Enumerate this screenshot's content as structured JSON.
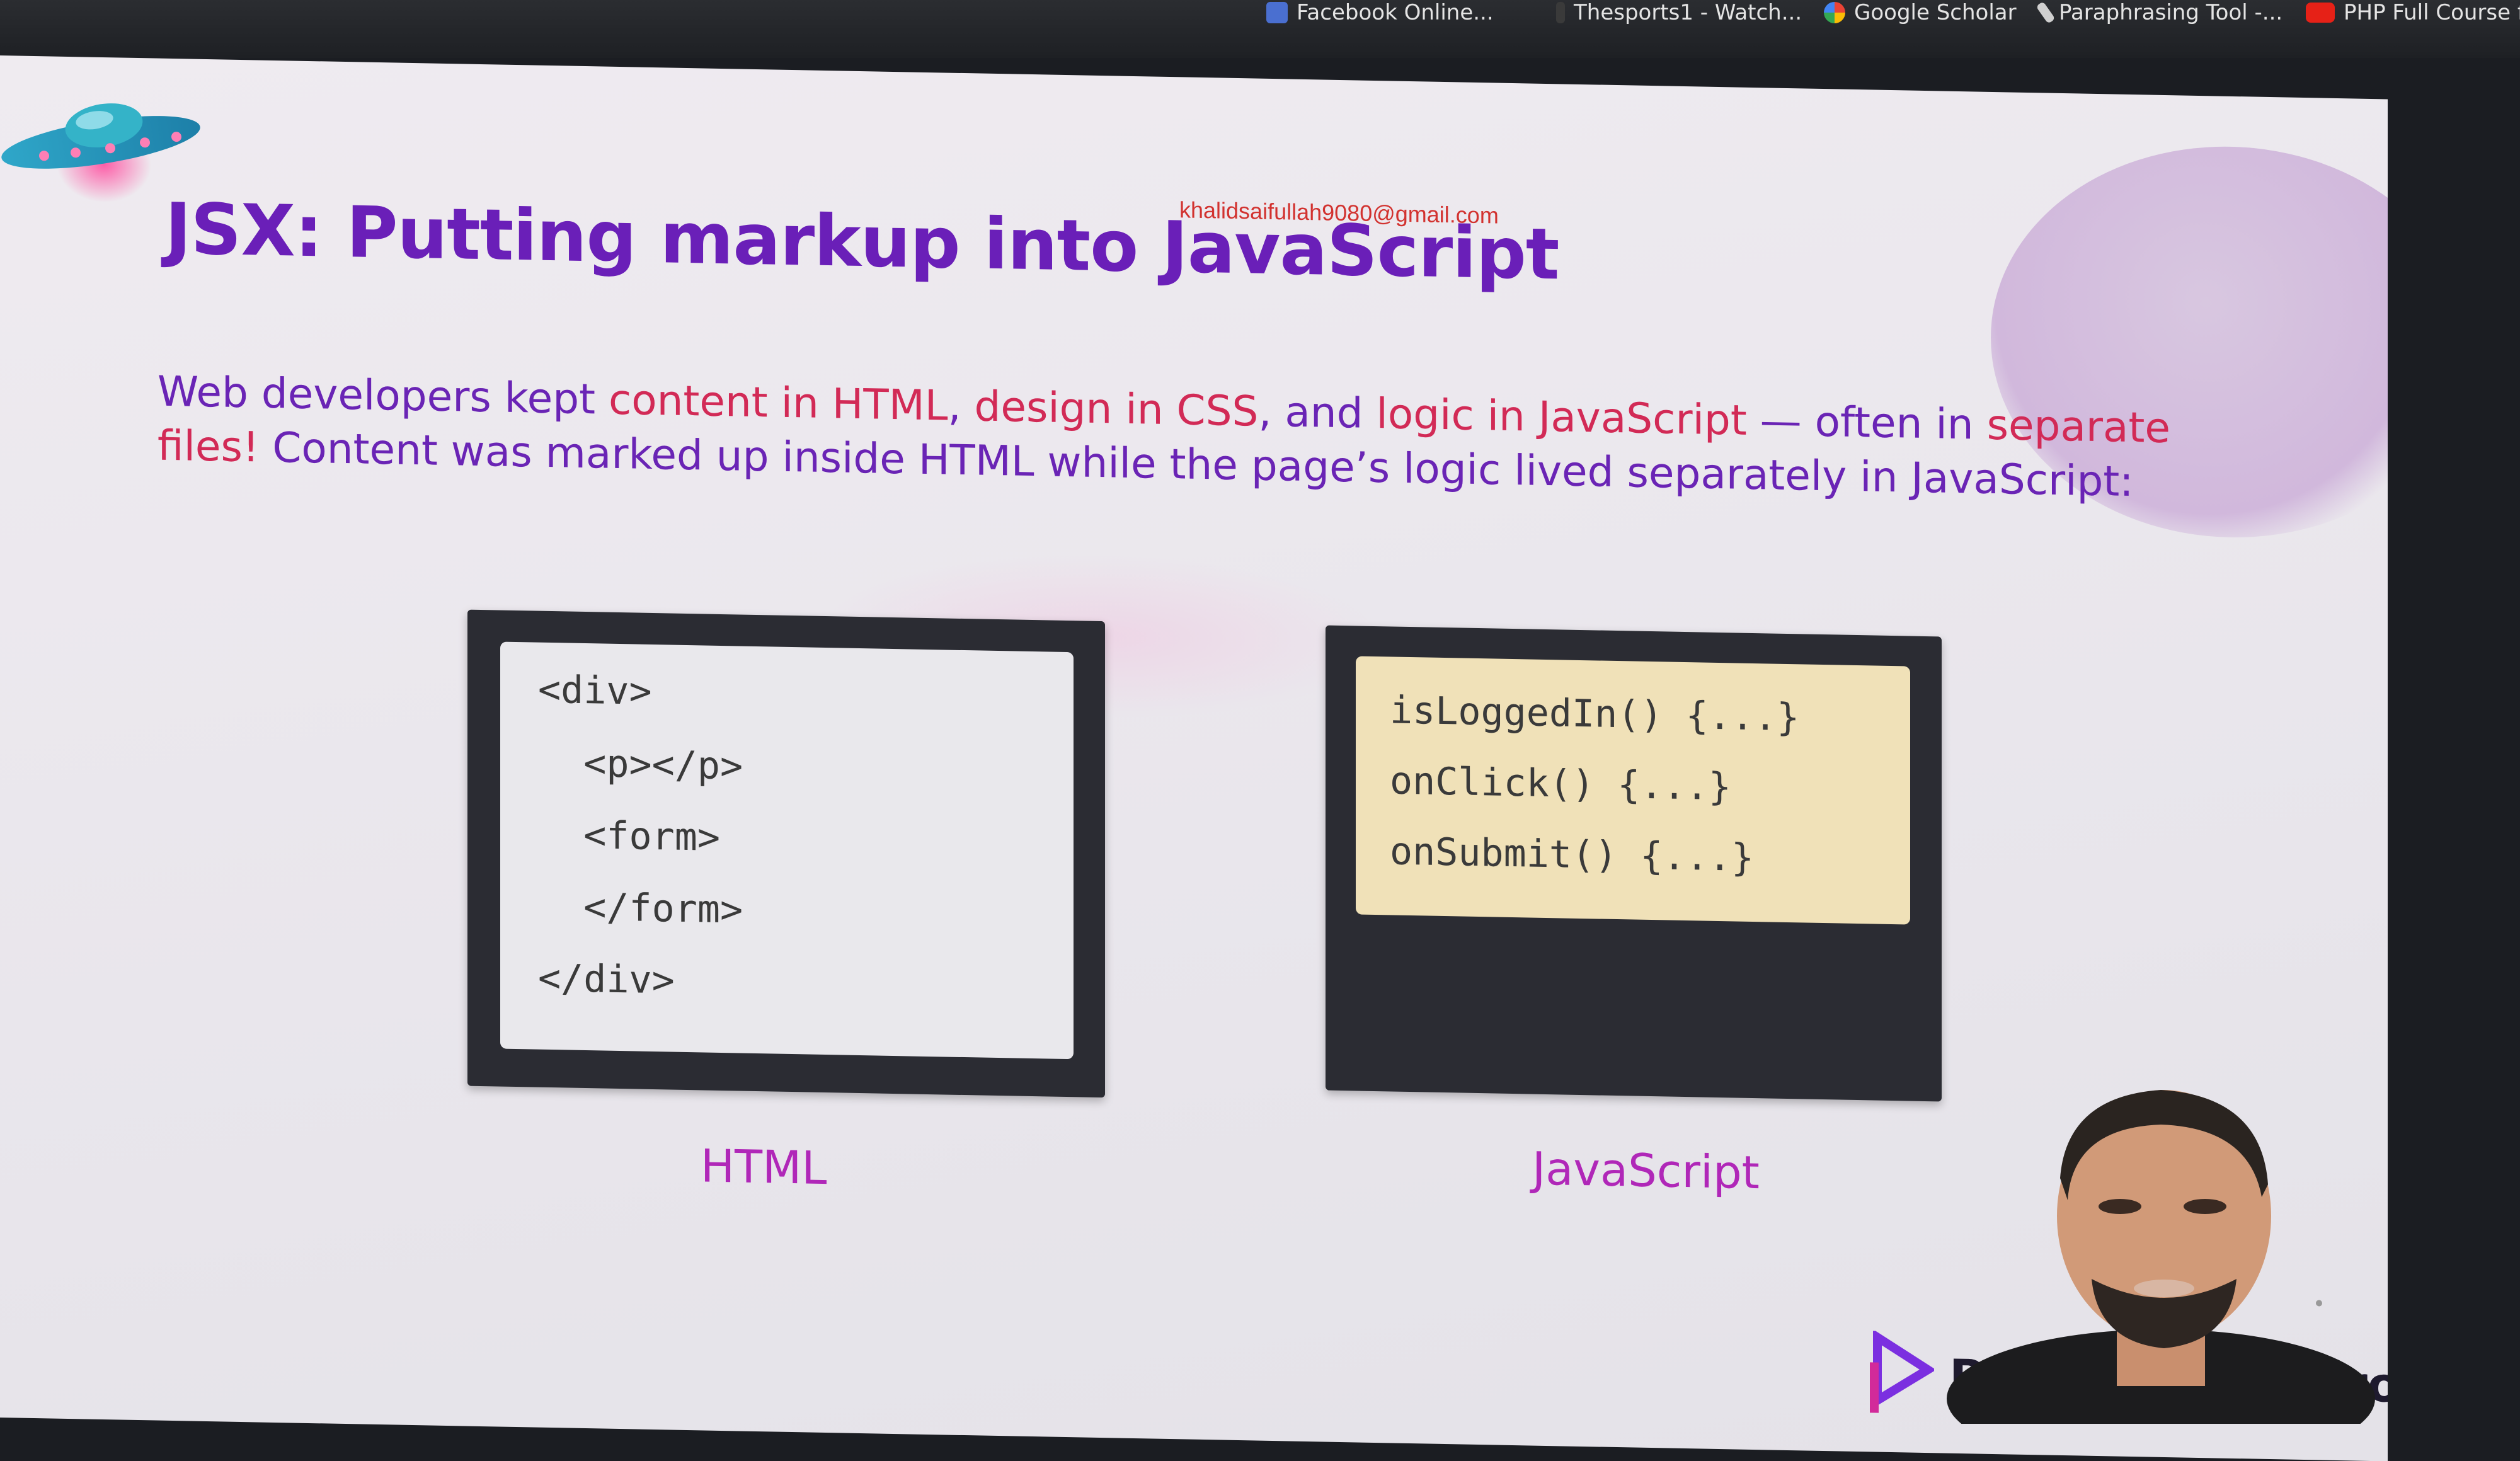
{
  "bookmarks": [
    {
      "label": "Facebook Online...",
      "icon": "bookmark-icon"
    },
    {
      "label": "Thesports1 - Watch...",
      "icon": "bookmark-icon"
    },
    {
      "label": "Google Scholar",
      "icon": "google-icon"
    },
    {
      "label": "Paraphrasing Tool -...",
      "icon": "pen-icon"
    },
    {
      "label": "PHP Full Course fo",
      "icon": "youtube-icon"
    }
  ],
  "slide": {
    "watermark_email": "khalidsaifullah9080@gmail.com",
    "title": "JSX: Putting markup into JavaScript",
    "body": {
      "line1_a": "Web developers kept ",
      "line1_b": "content in HTML",
      "line1_c": ", ",
      "line1_d": "design in CSS",
      "line1_e": ", and ",
      "line1_f": "logic in JavaScript",
      "line1_g": " — often in ",
      "line1_h": "separate",
      "line2_a": "files!",
      "line2_b": " Content was marked up inside HTML while the page’s logic lived  separately in JavaScript:"
    },
    "html_box": {
      "lines": [
        "<div>",
        "  <p></p>",
        "  <form>",
        "  </form>",
        "</div>"
      ],
      "caption": "HTML"
    },
    "js_box": {
      "lines": [
        "isLoggedIn() {...}",
        "onClick() {...}",
        "onSubmit() {...}"
      ],
      "caption": "JavaScript"
    },
    "brand": {
      "name_left": "Progr",
      "name_right": "Hero"
    }
  },
  "colors": {
    "title": "#6a1fb8",
    "highlight": "#d22a56",
    "caption": "#b027b8",
    "email": "#d2322f",
    "js_panel": "#f0e1b8"
  }
}
